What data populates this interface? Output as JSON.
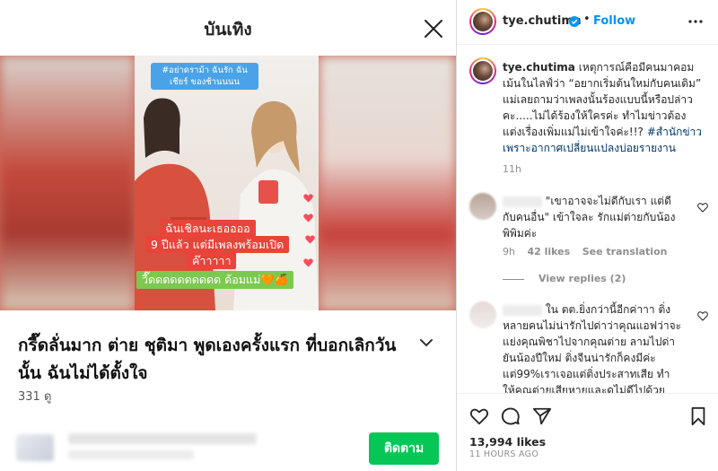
{
  "left": {
    "title": "บันเทิง",
    "video": {
      "hashtag_text": "#อย่าดราม้า ฉันรัก ฉันเชียร์ ของช้านนนน",
      "caption_1": "ฉันเชิลนะเธออออ",
      "caption_2": "9 ปีแล้ว แต่มีเพลงพร้อมเปิด",
      "caption_3": "ค๊าาาาา",
      "caption_4": "วี๊ดดดดดดดดดด ด้อมแม่🧡🍊"
    },
    "post_title": "กรี๊ดลั่นมาก ต่าย ชุติมา พูดเองครั้งแรก ที่บอกเลิกวันนั้น ฉันไม่ได้ตั้งใจ",
    "view_count": "331 ดู",
    "follow_label": "ติดตาม",
    "colors": {
      "follow_green": "#06c755"
    }
  },
  "right": {
    "header": {
      "username": "tye.chutima",
      "dot": "•",
      "follow_label": "Follow"
    },
    "caption": {
      "username": "tye.chutima",
      "text": "เหตุการณ์คือมีคนมาคอมเม้นในไลฟ์ว่า “อยากเริ่มต้นใหม่กับคนเดิม” แม่เลยถามว่าเพลงนั้นร้องแบบนี้หรือปล่าวคะ.....ไม่ได้ร้องให้ใครค่ะ ทำไมข่าวต้องแต่งเรื่องเพิ่มแม่ไม่เข้าใจค่ะ!!?",
      "hashtag": "#สำนักข่าวเพราะอากาศเปลี่ยนแปลงบ่อยรายงาน",
      "time": "11h"
    },
    "comments": [
      {
        "text": "\"เขาอาจจะไม่ดีกับเรา แต่ดีกับคนอื่น\" เข้าใจละ รักแม่ต่ายกับน้องพิพิมค่ะ",
        "time": "9h",
        "likes": "42 likes",
        "translate": "See translation"
      },
      {
        "text": "ใน ตต.ยิ่งกว่านี้อีกค่าาา ติ่งหลายคนไม่น่ารักไปด่าว่าคุณแอฟว่าจะแย่งคุณพิชาไปจากคุณต่าย ลามไปด่ายันน้องปีใหม่ ติ่งจีนน่ารักก็คงมีค่ะแต่99%เราเจอแต่ติ่งประสาทเสีย ทำให้คุณต่ายเสียหายและดูไม่ดีไปด้วย ทั้งๆที่เรื่องราวก็ไม่มีอะไร😊"
      }
    ],
    "view_replies": "View replies (2)",
    "likes_count": "13,994 likes",
    "post_time": "11 HOURS AGO",
    "colors": {
      "link_blue": "#0095f6",
      "hashtag_blue": "#00376b"
    }
  }
}
